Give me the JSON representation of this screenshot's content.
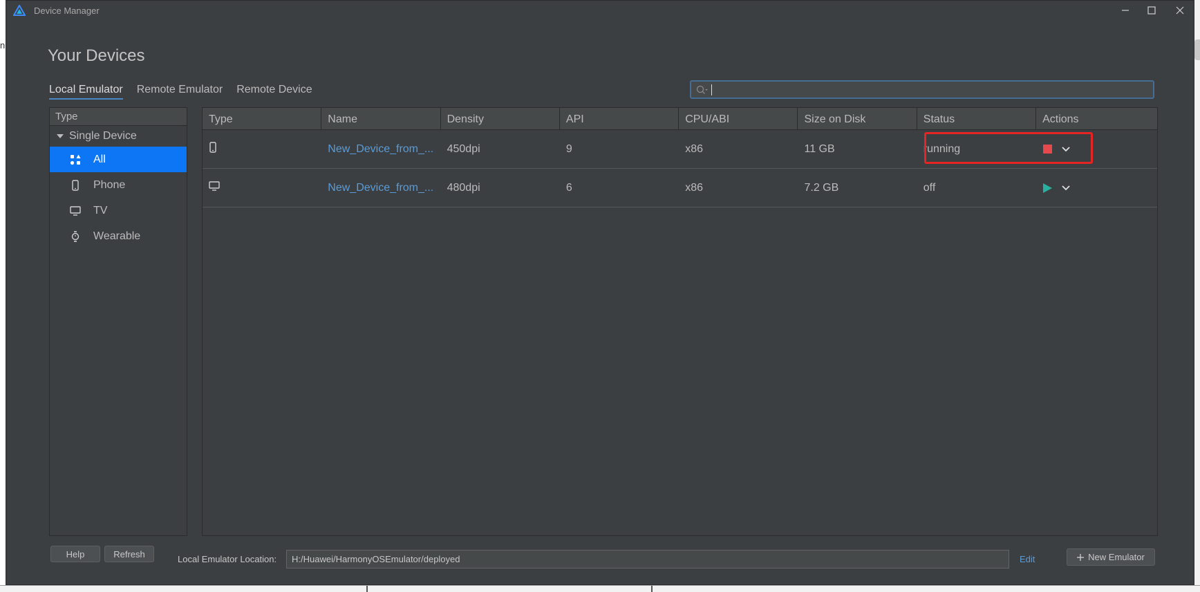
{
  "window": {
    "title": "Device Manager"
  },
  "background": {
    "left_fragment": "n"
  },
  "heading": "Your Devices",
  "tabs": [
    {
      "label": "Local Emulator",
      "active": true
    },
    {
      "label": "Remote Emulator",
      "active": false
    },
    {
      "label": "Remote Device",
      "active": false
    }
  ],
  "search": {
    "value": "",
    "placeholder": ""
  },
  "sidebar": {
    "header": "Type",
    "group": "Single Device",
    "items": [
      {
        "label": "All",
        "icon": "grid-icon",
        "active": true
      },
      {
        "label": "Phone",
        "icon": "phone-icon",
        "active": false
      },
      {
        "label": "TV",
        "icon": "tv-icon",
        "active": false
      },
      {
        "label": "Wearable",
        "icon": "watch-icon",
        "active": false
      }
    ]
  },
  "table": {
    "columns": [
      "Type",
      "Name",
      "Density",
      "API",
      "CPU/ABI",
      "Size on Disk",
      "Status",
      "Actions"
    ],
    "rows": [
      {
        "type_icon": "phone-icon",
        "name": "New_Device_from_...",
        "density": "450dpi",
        "api": "9",
        "cpu": "x86",
        "size": "11 GB",
        "status": "running",
        "action": "stop-icon"
      },
      {
        "type_icon": "tv-icon",
        "name": "New_Device_from_...",
        "density": "480dpi",
        "api": "6",
        "cpu": "x86",
        "size": "7.2 GB",
        "status": "off",
        "action": "play-icon"
      }
    ]
  },
  "footer": {
    "help_label": "Help",
    "refresh_label": "Refresh",
    "location_label": "Local Emulator Location:",
    "location_value": "H:/Huawei/HarmonyOSEmulator/deployed",
    "edit_label": "Edit",
    "new_emulator_label": "New Emulator"
  },
  "colors": {
    "accent": "#0d76f5",
    "link": "#5b9bd6",
    "stop": "#e5484d",
    "play": "#27b1a0",
    "highlight": "#e62424"
  }
}
